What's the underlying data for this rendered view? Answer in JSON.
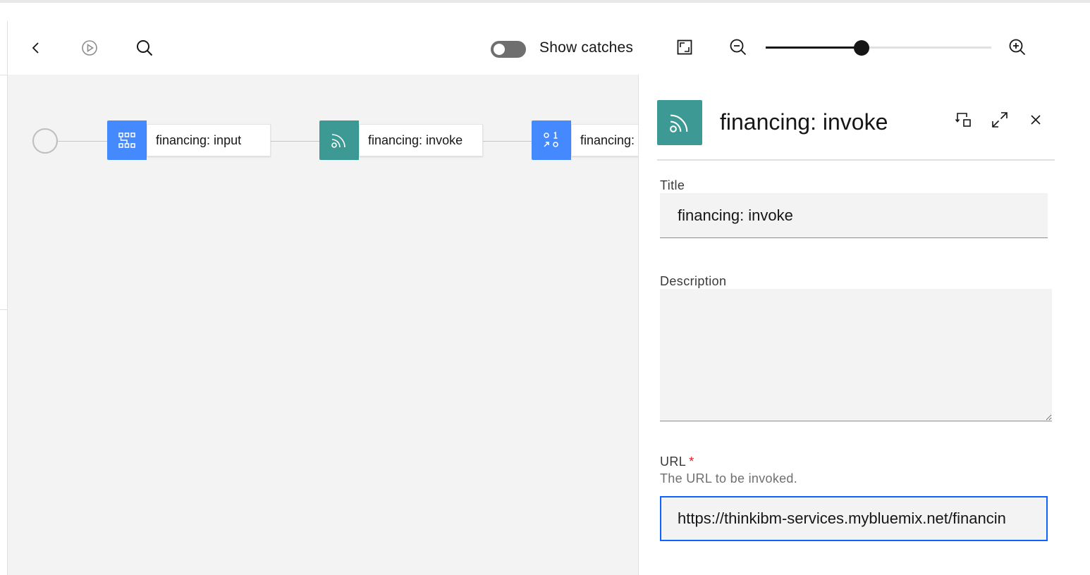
{
  "toolbar": {
    "back_icon": "chevron-left-icon",
    "run_icon": "play-circle-icon",
    "search_icon": "search-icon",
    "show_catches_label": "Show catches",
    "show_catches_on": false,
    "fit_icon": "fit-to-screen-icon",
    "zoom_out_icon": "zoom-out-icon",
    "zoom_in_icon": "zoom-in-icon",
    "zoom_level": 0.425
  },
  "flow": {
    "nodes": [
      {
        "label": "financing: input",
        "icon": "data-map-icon",
        "color": "#4589ff"
      },
      {
        "label": "financing: invoke",
        "icon": "rss-feed-icon",
        "color": "#3d9993"
      },
      {
        "label": "financing: ",
        "icon": "parse-icon",
        "color": "#4589ff"
      }
    ]
  },
  "panel": {
    "icon": "rss-feed-icon",
    "icon_color": "#3d9993",
    "title": "financing: invoke",
    "actions": [
      "swap-icon",
      "maximize-icon",
      "close-icon"
    ],
    "fields": {
      "title": {
        "label": "Title",
        "value": "financing: invoke"
      },
      "description": {
        "label": "Description",
        "value": ""
      },
      "url": {
        "label": "URL",
        "required_marker": "*",
        "helper": "The URL to be invoked.",
        "value": "https://thinkibm-services.mybluemix.net/financin"
      }
    }
  }
}
